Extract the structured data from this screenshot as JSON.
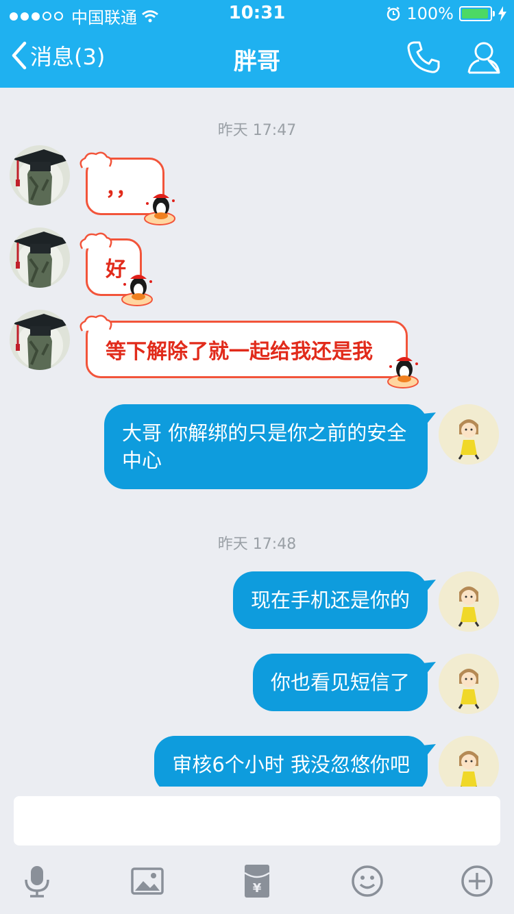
{
  "status_bar": {
    "carrier": "中国联通",
    "time": "10:31",
    "battery_text": "100%"
  },
  "nav": {
    "back_label": "消息(3)",
    "title": "胖哥"
  },
  "timestamps": [
    "昨天 17:47",
    "昨天 17:48"
  ],
  "messages": [
    {
      "from": "friend",
      "text": "，，"
    },
    {
      "from": "friend",
      "text": "好"
    },
    {
      "from": "friend",
      "text": "等下解除了就一起给我还是我"
    },
    {
      "from": "me",
      "text": "大哥 你解绑的只是你之前的安全中心"
    },
    {
      "from": "me",
      "text": "现在手机还是你的"
    },
    {
      "from": "me",
      "text": "你也看见短信了"
    },
    {
      "from": "me",
      "text": "审核6个小时 我没忽悠你吧"
    }
  ],
  "input": {
    "value": ""
  },
  "toolbar": {
    "icons": [
      "microphone-icon",
      "image-icon",
      "red-packet-icon",
      "emoji-icon",
      "plus-icon"
    ]
  },
  "colors": {
    "nav_blue": "#1fb1f0",
    "bubble_blue": "#0e9cdd",
    "bubble_red_text": "#e12b1b",
    "bubble_red_border": "#f2543a",
    "background": "#ebedf2"
  }
}
